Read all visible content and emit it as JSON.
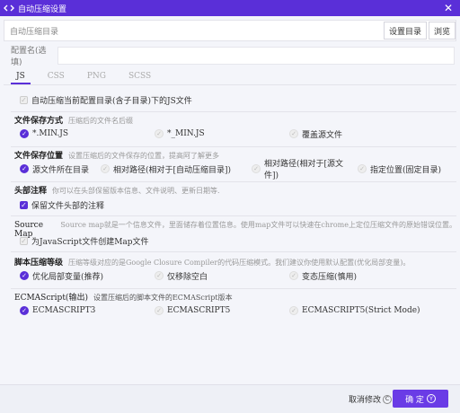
{
  "window": {
    "title": "自动压缩设置",
    "close_icon": "close-icon",
    "app_icon": "code-icon"
  },
  "dir": {
    "label": "自动压缩目录",
    "value": "",
    "set_button": "设置目录",
    "browse_button": "浏览"
  },
  "config": {
    "label": "配置名(选填)",
    "value": ""
  },
  "tabs": [
    {
      "label": "JS",
      "active": true
    },
    {
      "label": "CSS",
      "active": false
    },
    {
      "label": "PNG",
      "active": false
    },
    {
      "label": "SCSS",
      "active": false
    }
  ],
  "auto_compress_all": {
    "label": "自动压缩当前配置目录(含子目录)下的JS文件",
    "checked": true
  },
  "save_name": {
    "title": "文件保存方式",
    "desc": "压缩后的文件名后缀",
    "options": [
      {
        "label": "*.MIN.JS",
        "selected": true
      },
      {
        "label": "*_MIN.JS",
        "selected": false
      },
      {
        "label": "覆盖源文件",
        "selected": false
      }
    ]
  },
  "save_location": {
    "title": "文件保存位置",
    "desc": "设置压缩后的文件保存的位置，提高阿了解更多",
    "options": [
      {
        "label": "源文件所在目录",
        "selected": true
      },
      {
        "label": "相对路径(相对于[自动压缩目录])",
        "selected": false
      },
      {
        "label": "相对路径(相对于[源文件])",
        "selected": false
      },
      {
        "label": "指定位置(固定目录)",
        "selected": false
      }
    ]
  },
  "header_comment": {
    "title": "头部注释",
    "desc": "你可以在头部保留版本信息、文件说明、更新日期等.",
    "checkbox": {
      "label": "保留文件头部的注释",
      "checked": true
    }
  },
  "source_map": {
    "title": "Source Map",
    "desc": "Source map就是一个信息文件，里面储存着位置信息。使用map文件可以快速在chrome上定位压缩文件的原始错误位置。",
    "checkbox": {
      "label": "为JavaScript文件创建Map文件",
      "checked": false
    }
  },
  "compress_level": {
    "title": "脚本压缩等级",
    "desc": "压缩等级对应的是Google Closure Compiler的代码压缩模式。我们建议你使用默认配置(优化局部变量)。",
    "options": [
      {
        "label": "优化局部变量(推荐)",
        "selected": true
      },
      {
        "label": "仅移除空白",
        "selected": false
      },
      {
        "label": "变态压缩(慎用)",
        "selected": false
      }
    ]
  },
  "ecmascript": {
    "title": "ECMAScript(输出)",
    "desc": "设置压缩后的脚本文件的ECMAScript版本",
    "options": [
      {
        "label": "ECMASCRIPT3",
        "selected": true
      },
      {
        "label": "ECMASCRIPT5",
        "selected": false
      },
      {
        "label": "ECMASCRIPT5(Strict Mode)",
        "selected": false
      }
    ]
  },
  "footer": {
    "cancel": "取消修改",
    "cancel_key": "C",
    "ok": "确 定",
    "ok_key": "Y"
  },
  "colors": {
    "accent": "#5a2fd8",
    "titlebar": "#5a2fd8",
    "ok_button": "#6a3ce6"
  }
}
